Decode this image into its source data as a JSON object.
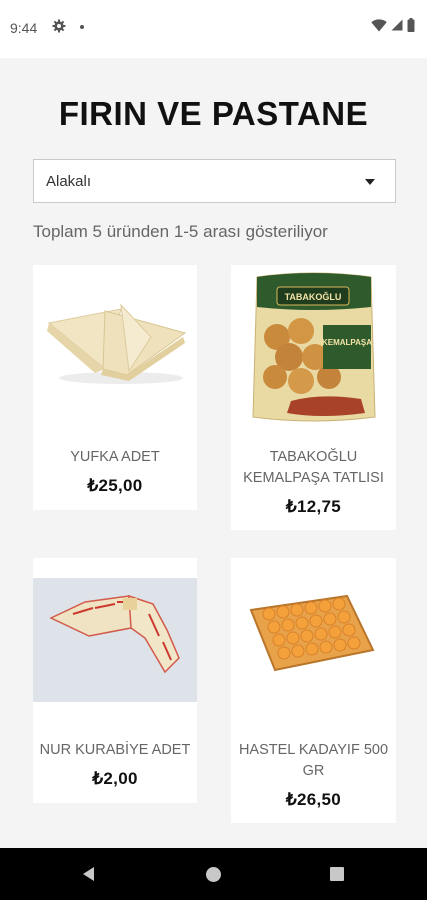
{
  "status": {
    "time": "9:44"
  },
  "page": {
    "title": "FIRIN VE PASTANE",
    "sort": {
      "selected": "Alakalı"
    },
    "result_count": "Toplam 5 üründen 1-5 arası gösteriliyor"
  },
  "products": [
    {
      "name": "YUFKA ADET",
      "price": "₺25,00"
    },
    {
      "name": "TABAKOĞLU KEMALPAŞA TATLISI",
      "price": "₺12,75"
    },
    {
      "name": "NUR KURABİYE ADET",
      "price": "₺2,00"
    },
    {
      "name": "HASTEL KADAYIF 500 GR",
      "price": "₺26,50"
    }
  ],
  "package_text": {
    "brand": "TABAKOĞLU",
    "product": "KEMALPAŞA"
  },
  "colors": {
    "background": "#f4f4f4",
    "card": "#ffffff",
    "title": "#111111",
    "muted_text": "#666666",
    "nav_bar": "#000000"
  },
  "icons": {
    "status": [
      "gear-icon",
      "notification-dot-icon",
      "wifi-icon",
      "cell-signal-icon",
      "battery-icon"
    ],
    "nav": [
      "back-icon",
      "home-icon",
      "recents-icon"
    ],
    "dropdown": "chevron-down-icon"
  }
}
